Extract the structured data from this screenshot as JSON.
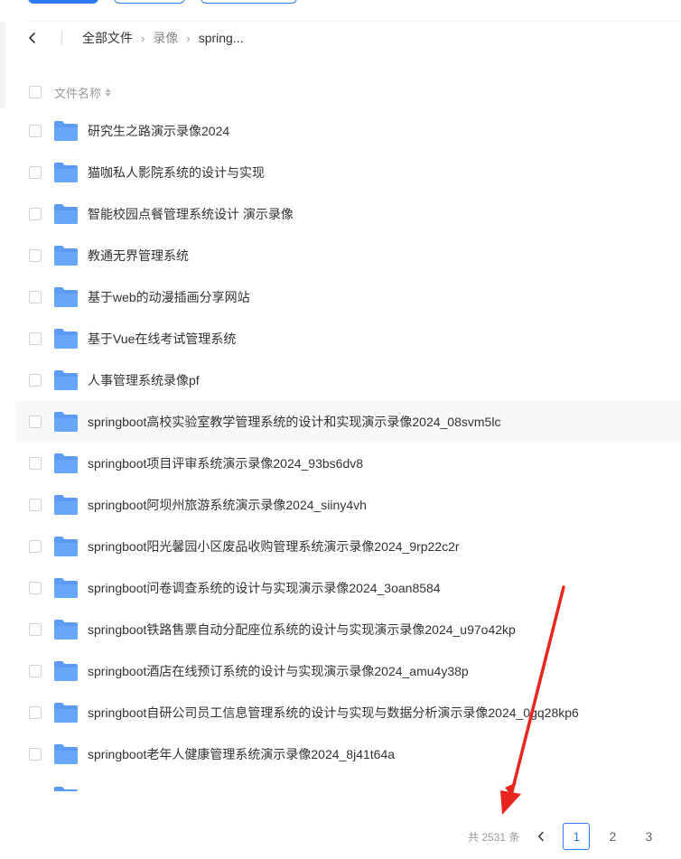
{
  "breadcrumb": {
    "items": [
      "全部文件",
      "录像",
      "spring..."
    ]
  },
  "list": {
    "header_label": "文件名称",
    "rows": [
      "研究生之路演示录像2024",
      "猫咖私人影院系统的设计与实现",
      "智能校园点餐管理系统设计 演示录像",
      "教通无界管理系统",
      "基于web的动漫插画分享网站",
      "基于Vue在线考试管理系统",
      "人事管理系统录像pf",
      "springboot高校实验室教学管理系统的设计和实现演示录像2024_08svm5lc",
      "springboot项目评审系统演示录像2024_93bs6dv8",
      "springboot阿坝州旅游系统演示录像2024_siiny4vh",
      "springboot阳光馨园小区废品收购管理系统演示录像2024_9rp22c2r",
      "springboot问卷调查系统的设计与实现演示录像2024_3oan8584",
      "springboot铁路售票自动分配座位系统的设计与实现演示录像2024_u97o42kp",
      "springboot酒店在线预订系统的设计与实现演示录像2024_amu4y38p",
      "springboot自研公司员工信息管理系统的设计与实现与数据分析演示录像2024_0gq28kp6",
      "springboot老年人健康管理系统演示录像2024_8j41t64a"
    ]
  },
  "pagination": {
    "total_text": "共 2531 条",
    "pages": [
      "1",
      "2",
      "3"
    ],
    "current_page": "1"
  },
  "colors": {
    "accent": "#2f7bf5",
    "folder": "#5b9af5",
    "annotation": "#e8261f",
    "hover_row": "#f7f8fa"
  },
  "icons": {
    "back": "chevron-left-icon",
    "folder": "folder-icon",
    "sort": "sort-icon",
    "prev_page": "chevron-left-icon"
  }
}
